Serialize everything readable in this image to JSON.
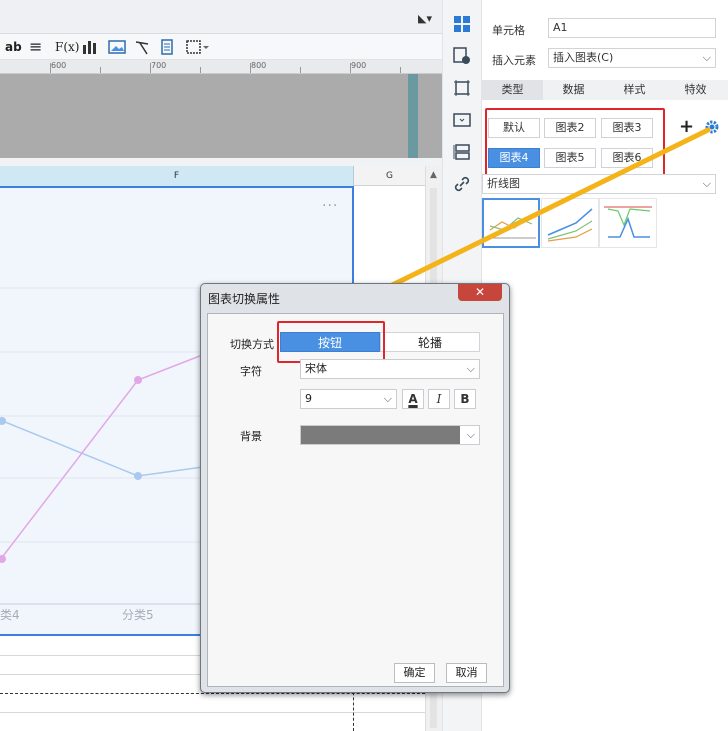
{
  "toolbar": {
    "items": [
      "ab",
      "≡",
      "F(x)"
    ]
  },
  "ruler": {
    "labels": [
      "600",
      "700",
      "800",
      "900"
    ]
  },
  "grid": {
    "col_f": "F",
    "col_g": "G",
    "more": "···"
  },
  "chart_data": {
    "type": "line",
    "categories": [
      "类4",
      "分类5"
    ],
    "series": [
      {
        "values": [
          null,
          null
        ],
        "color": "#a9c9ef"
      },
      {
        "values": [
          null,
          null
        ],
        "color": "#e2a8e6"
      }
    ]
  },
  "right_panel": {
    "cell_label": "单元格",
    "cell_value": "A1",
    "insert_label": "插入元素",
    "insert_value": "插入图表(C)",
    "tabs": [
      "类型",
      "数据",
      "样式",
      "特效"
    ],
    "chart_buttons": [
      "默认",
      "图表2",
      "图表3",
      "图表4",
      "图表5",
      "图表6"
    ],
    "add_symbol": "+",
    "chart_type": "折线图"
  },
  "dialog": {
    "title": "图表切换属性",
    "close": "✕",
    "switch_label": "切换方式",
    "switch_options": [
      "按钮",
      "轮播"
    ],
    "font_label": "字符",
    "font_value": "宋体",
    "size_value": "9",
    "style_buttons": [
      "A",
      "I",
      "B"
    ],
    "bg_label": "背景",
    "ok": "确定",
    "cancel": "取消"
  },
  "colors": {
    "accent": "#4a90e2",
    "highlight": "#e0262b",
    "arrow": "#f5b31a"
  }
}
